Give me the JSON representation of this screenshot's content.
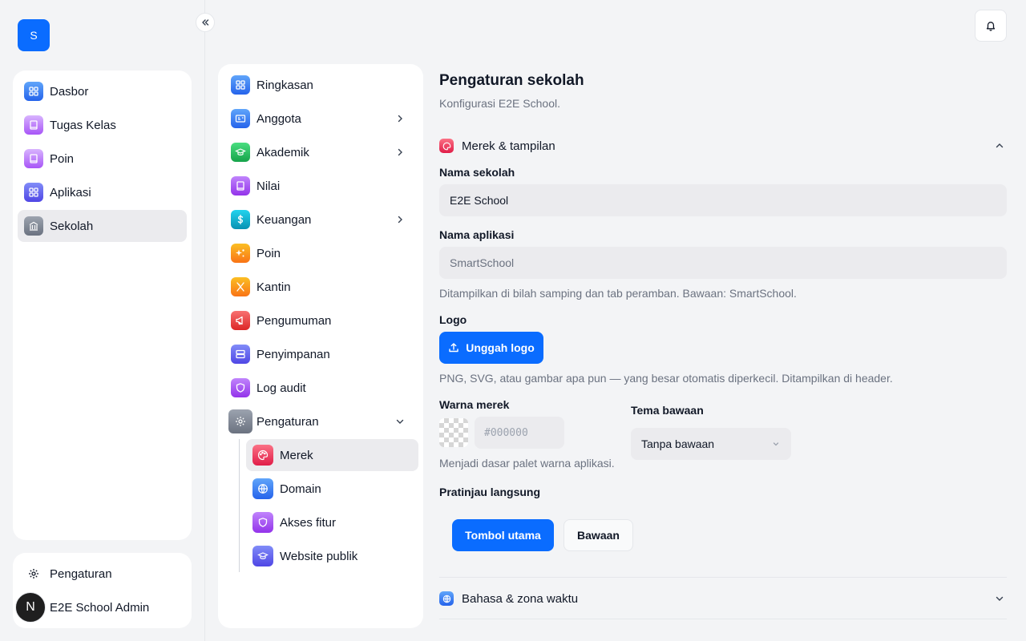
{
  "app": {
    "logo_letter": "S"
  },
  "sidebar": {
    "items": [
      {
        "label": "Dasbor",
        "icon": "grid-icon",
        "color": "#3b82f6"
      },
      {
        "label": "Tugas Kelas",
        "icon": "book-icon",
        "color": "#c084fc"
      },
      {
        "label": "Poin",
        "icon": "book-icon",
        "color": "#c084fc"
      },
      {
        "label": "Aplikasi",
        "icon": "grid-icon",
        "color": "#6366f1"
      },
      {
        "label": "Sekolah",
        "icon": "building-icon",
        "color": "#6b7280",
        "active": true
      }
    ],
    "settings_label": "Pengaturan",
    "user_name": "E2E School Admin",
    "user_initial": "N"
  },
  "settings_menu": {
    "items": [
      {
        "label": "Ringkasan",
        "icon": "grid-icon",
        "color": "#3b82f6"
      },
      {
        "label": "Anggota",
        "icon": "id-card-icon",
        "color": "#3b82f6",
        "chevron": true
      },
      {
        "label": "Akademik",
        "icon": "graduation-cap-icon",
        "color": "#22c55e",
        "chevron": true
      },
      {
        "label": "Nilai",
        "icon": "book-icon",
        "color": "#a855f7"
      },
      {
        "label": "Keuangan",
        "icon": "dollar-icon",
        "color": "#06b6d4",
        "chevron": true
      },
      {
        "label": "Poin",
        "icon": "sparkle-icon",
        "color": "#f59e0b"
      },
      {
        "label": "Kantin",
        "icon": "utensils-icon",
        "color": "#f59e0b"
      },
      {
        "label": "Pengumuman",
        "icon": "megaphone-icon",
        "color": "#ef4444"
      },
      {
        "label": "Penyimpanan",
        "icon": "server-icon",
        "color": "#6366f1"
      },
      {
        "label": "Log audit",
        "icon": "shield-icon",
        "color": "#a855f7"
      },
      {
        "label": "Pengaturan",
        "icon": "gear-icon",
        "color": "#6b7280",
        "expanded": true
      }
    ],
    "sub_items": [
      {
        "label": "Merek",
        "icon": "palette-icon",
        "color": "#f43f5e",
        "active": true
      },
      {
        "label": "Domain",
        "icon": "globe-icon",
        "color": "#3b82f6"
      },
      {
        "label": "Akses fitur",
        "icon": "shield-icon",
        "color": "#a855f7"
      },
      {
        "label": "Website publik",
        "icon": "graduation-cap-icon",
        "color": "#6366f1"
      }
    ]
  },
  "main": {
    "title": "Pengaturan sekolah",
    "subtitle": "Konfigurasi E2E School.",
    "brand_section": {
      "heading": "Merek & tampilan",
      "school_name_label": "Nama sekolah",
      "school_name_value": "E2E School",
      "app_name_label": "Nama aplikasi",
      "app_name_placeholder": "SmartSchool",
      "app_name_hint": "Ditampilkan di bilah samping dan tab peramban. Bawaan: SmartSchool.",
      "logo_label": "Logo",
      "upload_label": "Unggah logo",
      "logo_hint": "PNG, SVG, atau gambar apa pun — yang besar otomatis diperkecil. Ditampilkan di header.",
      "brand_color_label": "Warna merek",
      "brand_color_placeholder": "#000000",
      "brand_color_hint": "Menjadi dasar palet warna aplikasi.",
      "theme_label": "Tema bawaan",
      "theme_value": "Tanpa bawaan",
      "preview_label": "Pratinjau langsung",
      "preview_primary": "Tombol utama",
      "preview_secondary": "Bawaan"
    },
    "language_section": {
      "heading": "Bahasa & zona waktu"
    }
  },
  "colors": {
    "accent": "#0a6cff"
  }
}
